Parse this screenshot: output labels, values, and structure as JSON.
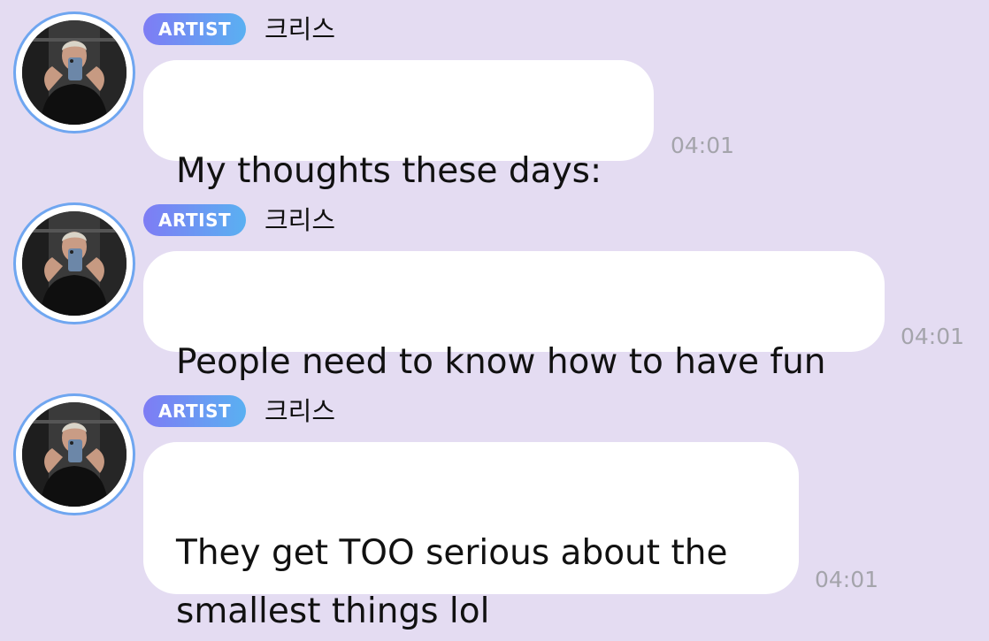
{
  "messages": [
    {
      "badge": "ARTIST",
      "sender": "크리스",
      "text": "My thoughts these days:",
      "time": "04:01",
      "avatar": "artist-avatar"
    },
    {
      "badge": "ARTIST",
      "sender": "크리스",
      "text": "People need to know how to have fun",
      "time": "04:01",
      "avatar": "artist-avatar"
    },
    {
      "badge": "ARTIST",
      "sender": "크리스",
      "text": "They get TOO serious about the\nsmallest things lol",
      "time": "04:01",
      "avatar": "artist-avatar"
    }
  ],
  "colors": {
    "background": "#e4dcf2",
    "bubble": "#ffffff",
    "avatar_ring": "#6fa6f0",
    "badge_gradient_start": "#7e7cf4",
    "badge_gradient_end": "#5ab0f2",
    "timestamp": "#a4a4ab"
  }
}
